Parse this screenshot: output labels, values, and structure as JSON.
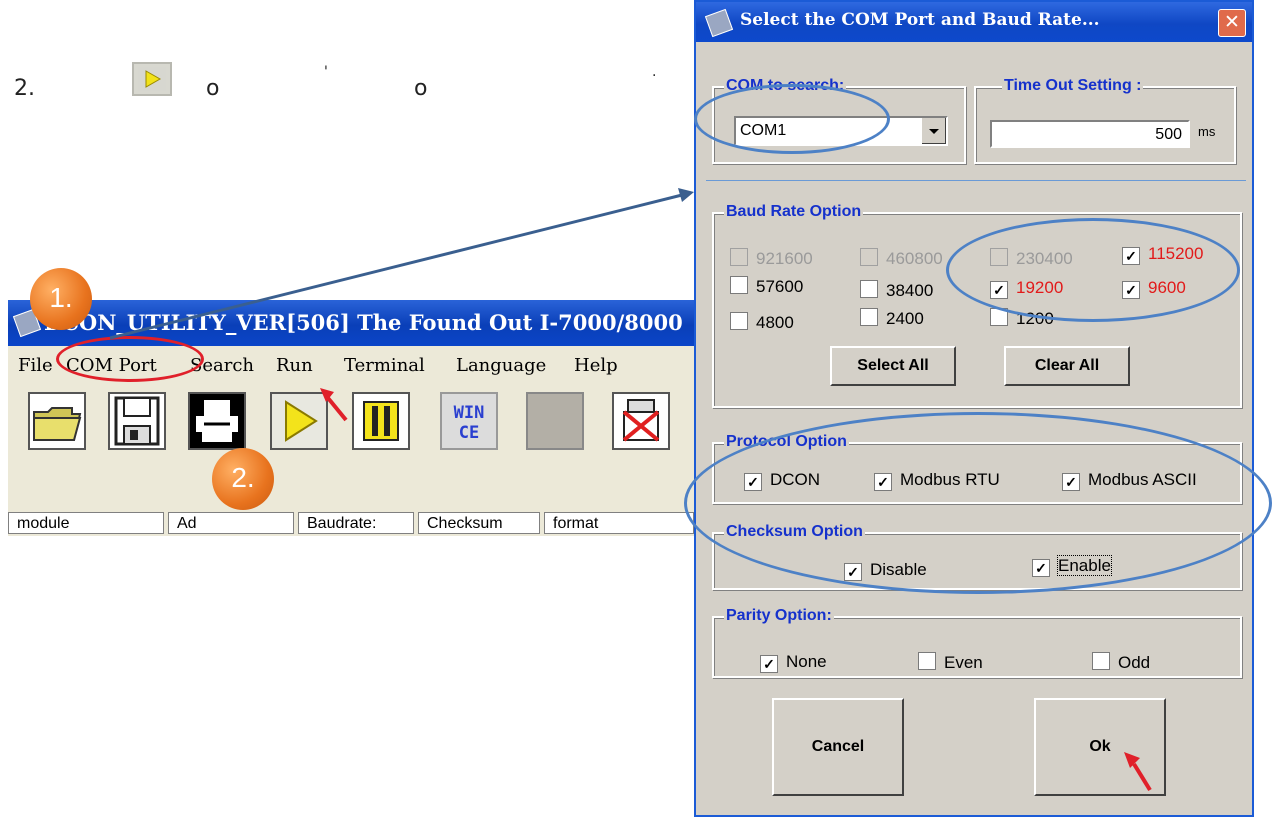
{
  "instructions": {
    "step2_number": "2.",
    "step2_circles": [
      "o",
      "o"
    ],
    "dots": [
      "'",
      "."
    ]
  },
  "main_window": {
    "title": "DCON_UTILITY_VER[506] The Found Out I-7000/8000",
    "menu": [
      "File",
      "COM Port",
      "Search",
      "Run",
      "Terminal",
      "Language",
      "Help"
    ],
    "toolbar_icons": [
      "open-folder-icon",
      "save-disk-icon",
      "print-icon",
      "run-play-icon",
      "pause-icon",
      "wince-icon",
      "blank-icon",
      "disconnect-icon"
    ],
    "wince_label": "WIN\nCE",
    "status_columns": [
      "module",
      "Address",
      "Baudrate:",
      "Checksum",
      "format"
    ],
    "status_visible": [
      "module",
      "Ad",
      "Baudrate:",
      "Checksum",
      "format"
    ]
  },
  "dialog": {
    "title": "Select the COM Port and Baud Rate...",
    "close_label": "✕",
    "com_group": {
      "label": "COM to search:",
      "value": "COM1"
    },
    "timeout_group": {
      "label": "Time Out Setting :",
      "value": "500",
      "unit": "ms"
    },
    "baud_group": {
      "label": "Baud Rate Option",
      "options": [
        {
          "label": "921600",
          "checked": false,
          "enabled": false
        },
        {
          "label": "460800",
          "checked": false,
          "enabled": false
        },
        {
          "label": "230400",
          "checked": false,
          "enabled": false
        },
        {
          "label": "115200",
          "checked": true,
          "enabled": true,
          "highlight": true
        },
        {
          "label": "57600",
          "checked": false,
          "enabled": true
        },
        {
          "label": "38400",
          "checked": false,
          "enabled": true
        },
        {
          "label": "19200",
          "checked": true,
          "enabled": true,
          "highlight": true
        },
        {
          "label": "9600",
          "checked": true,
          "enabled": true,
          "highlight": true
        },
        {
          "label": "4800",
          "checked": false,
          "enabled": true
        },
        {
          "label": "2400",
          "checked": false,
          "enabled": true
        },
        {
          "label": "1200",
          "checked": false,
          "enabled": true
        }
      ],
      "select_all": "Select All",
      "clear_all": "Clear All"
    },
    "protocol_group": {
      "label": "Protocol Option",
      "options": [
        {
          "label": "DCON",
          "checked": true
        },
        {
          "label": "Modbus RTU",
          "checked": true
        },
        {
          "label": "Modbus ASCII",
          "checked": true
        }
      ]
    },
    "checksum_group": {
      "label": "Checksum  Option",
      "options": [
        {
          "label": "Disable",
          "checked": true
        },
        {
          "label": "Enable",
          "checked": true
        }
      ]
    },
    "parity_group": {
      "label": "Parity Option:",
      "options": [
        {
          "label": "None",
          "checked": true
        },
        {
          "label": "Even",
          "checked": false
        },
        {
          "label": "Odd",
          "checked": false
        }
      ]
    },
    "cancel": "Cancel",
    "ok": "Ok"
  },
  "annotations": {
    "badge1": "1.",
    "badge2": "2.",
    "ellipse_color": "#4d81c6",
    "menu_ellipse_color": "#e0202a",
    "arrow_color": "#3a5f8f",
    "pointer_color": "#e0202a"
  }
}
